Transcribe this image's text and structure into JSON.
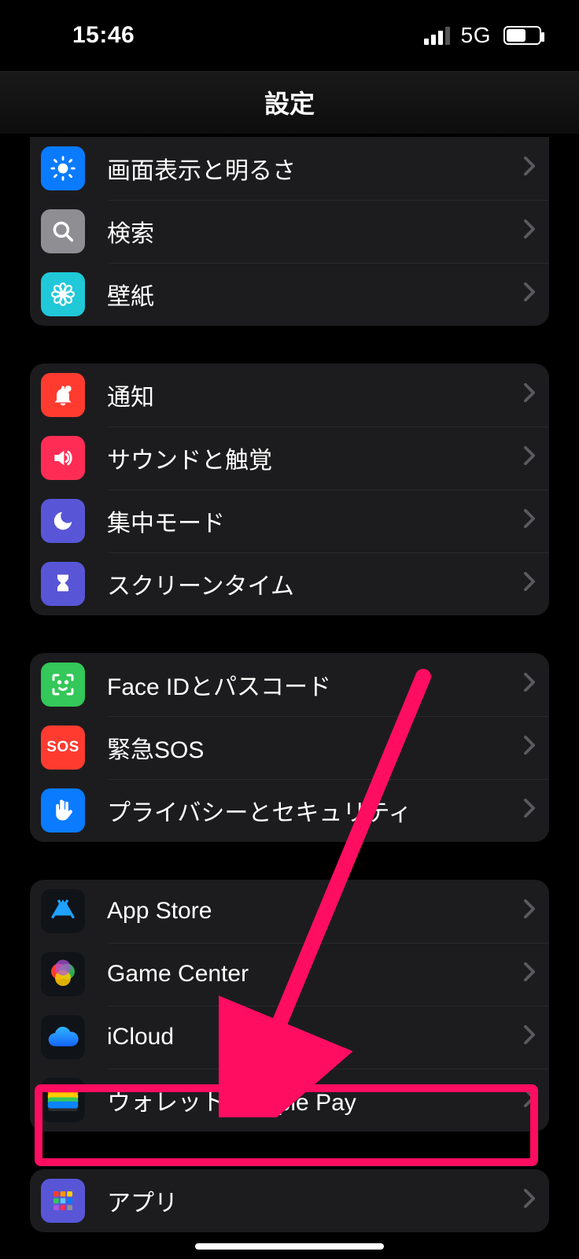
{
  "status": {
    "time": "15:46",
    "network": "5G"
  },
  "header": {
    "title": "設定"
  },
  "sections": [
    {
      "items": [
        {
          "id": "display",
          "label": "画面表示と明るさ",
          "icon": "sun",
          "bg": "#0a7bff"
        },
        {
          "id": "search",
          "label": "検索",
          "icon": "magnify",
          "bg": "#8e8e93"
        },
        {
          "id": "wallpaper",
          "label": "壁紙",
          "icon": "flower",
          "bg": "#20c8d8"
        }
      ]
    },
    {
      "items": [
        {
          "id": "notifications",
          "label": "通知",
          "icon": "bell",
          "bg": "#ff3b30"
        },
        {
          "id": "sounds",
          "label": "サウンドと触覚",
          "icon": "speaker",
          "bg": "#ff2d55"
        },
        {
          "id": "focus",
          "label": "集中モード",
          "icon": "moon",
          "bg": "#5856d6"
        },
        {
          "id": "screentime",
          "label": "スクリーンタイム",
          "icon": "hourglass",
          "bg": "#5856d6"
        }
      ]
    },
    {
      "items": [
        {
          "id": "faceid",
          "label": "Face IDとパスコード",
          "icon": "face",
          "bg": "#34c759"
        },
        {
          "id": "sos",
          "label": "緊急SOS",
          "icon": "sos",
          "bg": "#ff3b30"
        },
        {
          "id": "privacy",
          "label": "プライバシーとセキュリティ",
          "icon": "hand",
          "bg": "#0a7bff"
        }
      ]
    },
    {
      "items": [
        {
          "id": "appstore",
          "label": "App Store",
          "icon": "appstore",
          "bg": "#101318"
        },
        {
          "id": "gamecenter",
          "label": "Game Center",
          "icon": "gamecenter",
          "bg": "#101318"
        },
        {
          "id": "icloud",
          "label": "iCloud",
          "icon": "cloud",
          "bg": "#101318"
        },
        {
          "id": "wallet",
          "label": "ウォレットとApple Pay",
          "icon": "wallet",
          "bg": "#101318"
        }
      ]
    },
    {
      "items": [
        {
          "id": "apps",
          "label": "アプリ",
          "icon": "grid",
          "bg": "#5856d6"
        }
      ]
    }
  ]
}
